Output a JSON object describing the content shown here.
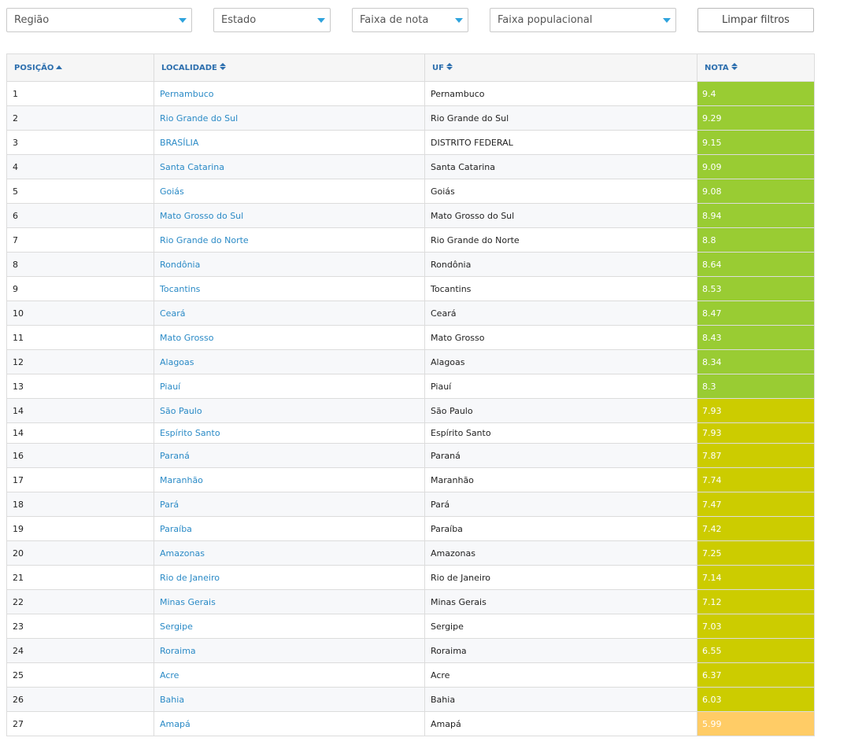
{
  "filters": {
    "regiao": "Região",
    "estado": "Estado",
    "faixa_nota": "Faixa de nota",
    "faixa_populacional": "Faixa populacional",
    "limpar": "Limpar filtros"
  },
  "table": {
    "headers": {
      "posicao": "POSIÇÃO",
      "localidade": "LOCALIDADE",
      "uf": "UF",
      "nota": "NOTA"
    },
    "rows": [
      {
        "pos": "1",
        "loc": "Pernambuco",
        "uf": "Pernambuco",
        "nota": "9.4"
      },
      {
        "pos": "2",
        "loc": "Rio Grande do Sul",
        "uf": "Rio Grande do Sul",
        "nota": "9.29"
      },
      {
        "pos": "3",
        "loc": "BRASÍLIA",
        "uf": "DISTRITO FEDERAL",
        "nota": "9.15"
      },
      {
        "pos": "4",
        "loc": "Santa Catarina",
        "uf": "Santa Catarina",
        "nota": "9.09"
      },
      {
        "pos": "5",
        "loc": "Goiás",
        "uf": "Goiás",
        "nota": "9.08"
      },
      {
        "pos": "6",
        "loc": "Mato Grosso do Sul",
        "uf": "Mato Grosso do Sul",
        "nota": "8.94"
      },
      {
        "pos": "7",
        "loc": "Rio Grande do Norte",
        "uf": "Rio Grande do Norte",
        "nota": "8.8"
      },
      {
        "pos": "8",
        "loc": "Rondônia",
        "uf": "Rondônia",
        "nota": "8.64"
      },
      {
        "pos": "9",
        "loc": "Tocantins",
        "uf": "Tocantins",
        "nota": "8.53"
      },
      {
        "pos": "10",
        "loc": "Ceará",
        "uf": "Ceará",
        "nota": "8.47"
      },
      {
        "pos": "11",
        "loc": "Mato Grosso",
        "uf": "Mato Grosso",
        "nota": "8.43"
      },
      {
        "pos": "12",
        "loc": "Alagoas",
        "uf": "Alagoas",
        "nota": "8.34"
      },
      {
        "pos": "13",
        "loc": "Piauí",
        "uf": "Piauí",
        "nota": "8.3"
      },
      {
        "pos": "14",
        "loc": "São Paulo",
        "uf": "São Paulo",
        "nota": "7.93"
      },
      {
        "pos": "14",
        "loc": "Espírito Santo",
        "uf": "Espírito Santo",
        "nota": "7.93"
      },
      {
        "pos": "16",
        "loc": "Paraná",
        "uf": "Paraná",
        "nota": "7.87"
      },
      {
        "pos": "17",
        "loc": "Maranhão",
        "uf": "Maranhão",
        "nota": "7.74"
      },
      {
        "pos": "18",
        "loc": "Pará",
        "uf": "Pará",
        "nota": "7.47"
      },
      {
        "pos": "19",
        "loc": "Paraíba",
        "uf": "Paraíba",
        "nota": "7.42"
      },
      {
        "pos": "20",
        "loc": "Amazonas",
        "uf": "Amazonas",
        "nota": "7.25"
      },
      {
        "pos": "21",
        "loc": "Rio de Janeiro",
        "uf": "Rio de Janeiro",
        "nota": "7.14"
      },
      {
        "pos": "22",
        "loc": "Minas Gerais",
        "uf": "Minas Gerais",
        "nota": "7.12"
      },
      {
        "pos": "23",
        "loc": "Sergipe",
        "uf": "Sergipe",
        "nota": "7.03"
      },
      {
        "pos": "24",
        "loc": "Roraima",
        "uf": "Roraima",
        "nota": "6.55"
      },
      {
        "pos": "25",
        "loc": "Acre",
        "uf": "Acre",
        "nota": "6.37"
      },
      {
        "pos": "26",
        "loc": "Bahia",
        "uf": "Bahia",
        "nota": "6.03"
      },
      {
        "pos": "27",
        "loc": "Amapá",
        "uf": "Amapá",
        "nota": "5.99"
      }
    ]
  },
  "colors": {
    "nota_high": "#99cc33",
    "nota_mid": "#cccc00",
    "nota_low": "#ffcc66",
    "link": "#2a8ac6",
    "header": "#2d6fae"
  }
}
